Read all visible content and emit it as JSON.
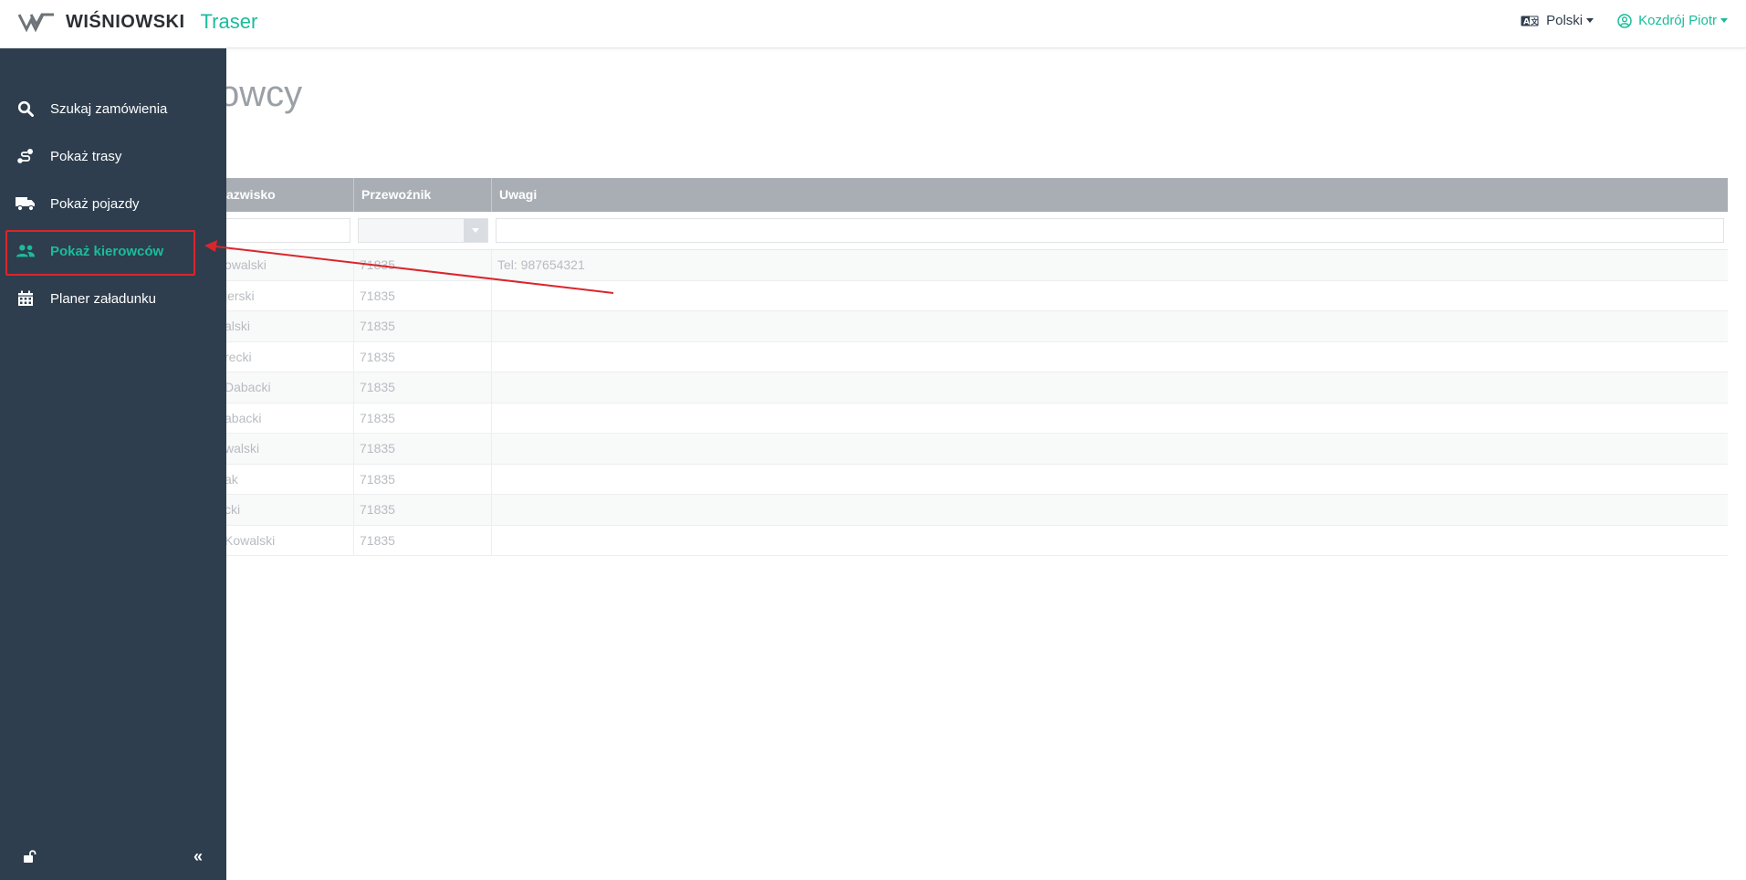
{
  "header": {
    "brand_name": "WIŚNIOWSKI",
    "app_name": "Traser",
    "language": "Polski",
    "user": "Kozdrój Piotr"
  },
  "page": {
    "title_visible": "owcy"
  },
  "table": {
    "columns": [
      "azwisko",
      "Przewoźnik",
      "Uwagi"
    ],
    "rows": [
      {
        "name": "owalski",
        "carrier": "71835",
        "notes": "Tel: 987654321"
      },
      {
        "name": "jerski",
        "carrier": "71835",
        "notes": ""
      },
      {
        "name": "alski",
        "carrier": "71835",
        "notes": ""
      },
      {
        "name": "recki",
        "carrier": "71835",
        "notes": ""
      },
      {
        "name": "Dabacki",
        "carrier": "71835",
        "notes": ""
      },
      {
        "name": "abacki",
        "carrier": "71835",
        "notes": ""
      },
      {
        "name": "walski",
        "carrier": "71835",
        "notes": ""
      },
      {
        "name": "ak",
        "carrier": "71835",
        "notes": ""
      },
      {
        "name": "cki",
        "carrier": "71835",
        "notes": ""
      },
      {
        "name": "Kowalski",
        "carrier": "71835",
        "notes": ""
      }
    ]
  },
  "sidebar": {
    "items": [
      {
        "label": "Szukaj zamówienia",
        "icon": "search-icon"
      },
      {
        "label": "Pokaż trasy",
        "icon": "route-icon"
      },
      {
        "label": "Pokaż pojazdy",
        "icon": "truck-icon"
      },
      {
        "label": "Pokaż kierowców",
        "icon": "users-icon",
        "active": true
      },
      {
        "label": "Planer załadunku",
        "icon": "calendar-icon"
      }
    ],
    "collapse_label": "«"
  },
  "colors": {
    "accent": "#1abc9c",
    "sidebar_bg": "#2e3e4e",
    "highlight_border": "#d9262c",
    "table_header_bg": "#a9aeb5"
  }
}
